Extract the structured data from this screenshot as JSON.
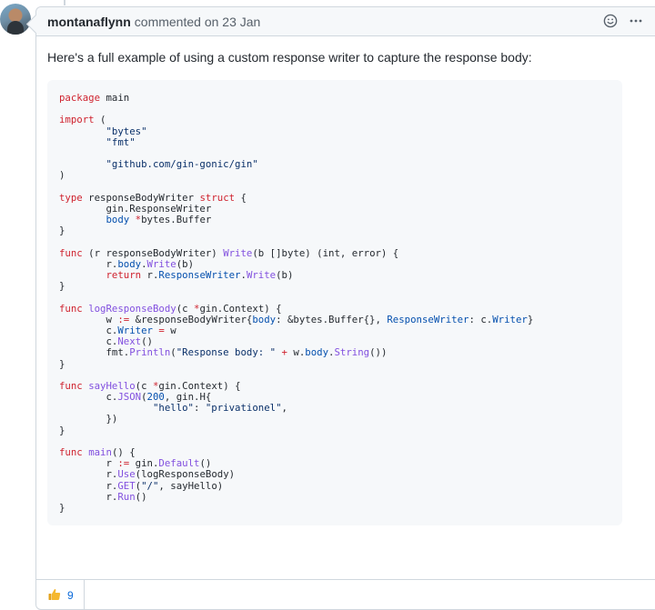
{
  "comment": {
    "author": "montanaflynn",
    "meta": "commented on 23 Jan",
    "intro": "Here's a full example of using a custom response writer to capture the response body:"
  },
  "code_lines": [
    [
      [
        "kw",
        "package"
      ],
      [
        "pl",
        " main"
      ]
    ],
    [],
    [
      [
        "kw",
        "import"
      ],
      [
        "pl",
        " ("
      ]
    ],
    [
      [
        "pl",
        "        "
      ],
      [
        "str",
        "\"bytes\""
      ]
    ],
    [
      [
        "pl",
        "        "
      ],
      [
        "str",
        "\"fmt\""
      ]
    ],
    [],
    [
      [
        "pl",
        "        "
      ],
      [
        "str",
        "\"github.com/gin-gonic/gin\""
      ]
    ],
    [
      [
        "pl",
        ")"
      ]
    ],
    [],
    [
      [
        "kw",
        "type"
      ],
      [
        "pl",
        " responseBodyWriter "
      ],
      [
        "kw",
        "struct"
      ],
      [
        "pl",
        " {"
      ]
    ],
    [
      [
        "pl",
        "        gin.ResponseWriter"
      ]
    ],
    [
      [
        "pl",
        "        "
      ],
      [
        "nm",
        "body"
      ],
      [
        "pl",
        " "
      ],
      [
        "kw",
        "*"
      ],
      [
        "pl",
        "bytes.Buffer"
      ]
    ],
    [
      [
        "pl",
        "}"
      ]
    ],
    [],
    [
      [
        "kw",
        "func"
      ],
      [
        "pl",
        " (r responseBodyWriter) "
      ],
      [
        "fn",
        "Write"
      ],
      [
        "pl",
        "(b []byte) (int, error) {"
      ]
    ],
    [
      [
        "pl",
        "        r."
      ],
      [
        "nm",
        "body"
      ],
      [
        "pl",
        "."
      ],
      [
        "fn",
        "Write"
      ],
      [
        "pl",
        "(b)"
      ]
    ],
    [
      [
        "pl",
        "        "
      ],
      [
        "kw",
        "return"
      ],
      [
        "pl",
        " r."
      ],
      [
        "nm",
        "ResponseWriter"
      ],
      [
        "pl",
        "."
      ],
      [
        "fn",
        "Write"
      ],
      [
        "pl",
        "(b)"
      ]
    ],
    [
      [
        "pl",
        "}"
      ]
    ],
    [],
    [
      [
        "kw",
        "func"
      ],
      [
        "pl",
        " "
      ],
      [
        "fn",
        "logResponseBody"
      ],
      [
        "pl",
        "(c "
      ],
      [
        "kw",
        "*"
      ],
      [
        "pl",
        "gin.Context) {"
      ]
    ],
    [
      [
        "pl",
        "        w "
      ],
      [
        "kw",
        ":="
      ],
      [
        "pl",
        " &responseBodyWriter{"
      ],
      [
        "nm",
        "body"
      ],
      [
        "pl",
        ": &bytes.Buffer{}, "
      ],
      [
        "nm",
        "ResponseWriter"
      ],
      [
        "pl",
        ": c."
      ],
      [
        "nm",
        "Writer"
      ],
      [
        "pl",
        "}"
      ]
    ],
    [
      [
        "pl",
        "        c."
      ],
      [
        "nm",
        "Writer"
      ],
      [
        "pl",
        " "
      ],
      [
        "kw",
        "="
      ],
      [
        "pl",
        " w"
      ]
    ],
    [
      [
        "pl",
        "        c."
      ],
      [
        "fn",
        "Next"
      ],
      [
        "pl",
        "()"
      ]
    ],
    [
      [
        "pl",
        "        fmt."
      ],
      [
        "fn",
        "Println"
      ],
      [
        "pl",
        "("
      ],
      [
        "str",
        "\"Response body: \""
      ],
      [
        "pl",
        " "
      ],
      [
        "kw",
        "+"
      ],
      [
        "pl",
        " w."
      ],
      [
        "nm",
        "body"
      ],
      [
        "pl",
        "."
      ],
      [
        "fn",
        "String"
      ],
      [
        "pl",
        "())"
      ]
    ],
    [
      [
        "pl",
        "}"
      ]
    ],
    [],
    [
      [
        "kw",
        "func"
      ],
      [
        "pl",
        " "
      ],
      [
        "fn",
        "sayHello"
      ],
      [
        "pl",
        "(c "
      ],
      [
        "kw",
        "*"
      ],
      [
        "pl",
        "gin.Context) {"
      ]
    ],
    [
      [
        "pl",
        "        c."
      ],
      [
        "fn",
        "JSON"
      ],
      [
        "pl",
        "("
      ],
      [
        "nm",
        "200"
      ],
      [
        "pl",
        ", gin.H{"
      ]
    ],
    [
      [
        "pl",
        "                "
      ],
      [
        "str",
        "\"hello\""
      ],
      [
        "pl",
        ": "
      ],
      [
        "str",
        "\"privationel\""
      ],
      [
        "pl",
        ","
      ]
    ],
    [
      [
        "pl",
        "        })"
      ]
    ],
    [
      [
        "pl",
        "}"
      ]
    ],
    [],
    [
      [
        "kw",
        "func"
      ],
      [
        "pl",
        " "
      ],
      [
        "fn",
        "main"
      ],
      [
        "pl",
        "() {"
      ]
    ],
    [
      [
        "pl",
        "        r "
      ],
      [
        "kw",
        ":="
      ],
      [
        "pl",
        " gin."
      ],
      [
        "fn",
        "Default"
      ],
      [
        "pl",
        "()"
      ]
    ],
    [
      [
        "pl",
        "        r."
      ],
      [
        "fn",
        "Use"
      ],
      [
        "pl",
        "(logResponseBody)"
      ]
    ],
    [
      [
        "pl",
        "        r."
      ],
      [
        "fn",
        "GET"
      ],
      [
        "pl",
        "("
      ],
      [
        "str",
        "\"/\""
      ],
      [
        "pl",
        ", sayHello)"
      ]
    ],
    [
      [
        "pl",
        "        r."
      ],
      [
        "fn",
        "Run"
      ],
      [
        "pl",
        "()"
      ]
    ],
    [
      [
        "pl",
        "}"
      ]
    ]
  ],
  "reactions": {
    "thumbs_up_icon": "thumbs-up-icon",
    "thumbs_up_count": "9"
  },
  "icons": {
    "header": [
      "smiley-icon",
      "kebab-horizontal-icon"
    ]
  },
  "colors": {
    "keyword": "#cf222e",
    "string": "#0a3069",
    "function": "#8250df",
    "name": "#0550ae",
    "link": "#0969da"
  }
}
